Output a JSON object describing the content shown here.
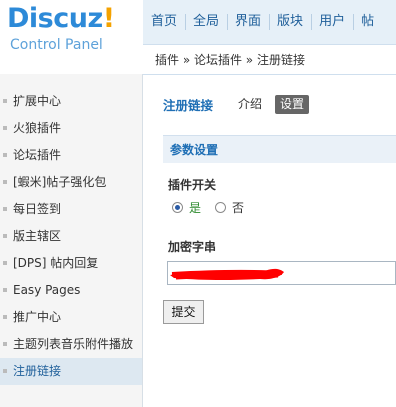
{
  "logo": {
    "brand": "Discuz",
    "brand_mark": "!",
    "subtitle": "Control Panel"
  },
  "topnav": [
    "首页",
    "全局",
    "界面",
    "版块",
    "用户",
    "帖"
  ],
  "breadcrumb": "插件 » 论坛插件 » 注册链接",
  "sidebar": {
    "items": [
      "扩展中心",
      "火狼插件",
      "论坛插件",
      "[蝦米]帖子强化包",
      "每日签到",
      "版主辖区",
      "[DPS] 帖内回复",
      "Easy Pages",
      "推广中心",
      "主题列表音乐附件播放",
      "注册链接"
    ],
    "active_index": 10
  },
  "tabs": {
    "title": "注册链接",
    "intro": "介绍",
    "settings": "设置",
    "active": "设置"
  },
  "section_title": "参数设置",
  "plugin_switch": {
    "label": "插件开关",
    "yes": "是",
    "no": "否",
    "selected": "是"
  },
  "secret_key": {
    "label": "加密字串",
    "value_redacted": true
  },
  "submit_label": "提交",
  "colors": {
    "brand_blue": "#2d8ad8",
    "brand_orange": "#f4a200",
    "redaction": "#ff0000",
    "link_blue": "#1f6fb5"
  }
}
